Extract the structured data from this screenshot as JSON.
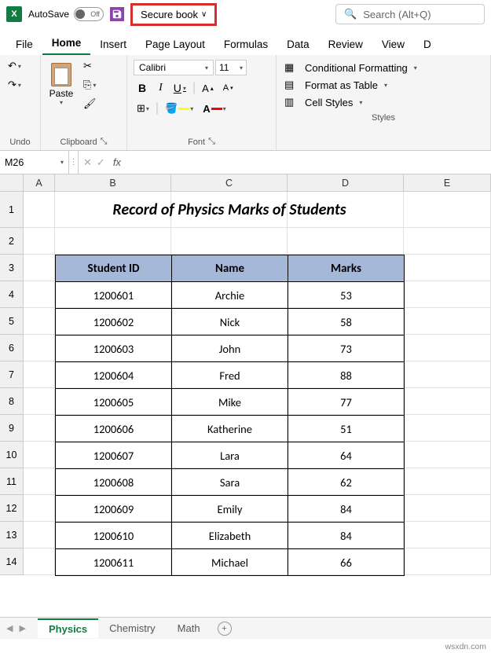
{
  "titleBar": {
    "autoSave": "AutoSave",
    "toggleState": "Off",
    "filename": "Secure book",
    "searchPlaceholder": "Search (Alt+Q)"
  },
  "ribbonTabs": [
    "File",
    "Home",
    "Insert",
    "Page Layout",
    "Formulas",
    "Data",
    "Review",
    "View",
    "D"
  ],
  "activeTab": "Home",
  "ribbon": {
    "undo": {
      "label": "Undo"
    },
    "clipboard": {
      "label": "Clipboard",
      "paste": "Paste"
    },
    "font": {
      "label": "Font",
      "name": "Calibri",
      "size": "11",
      "bold": "B",
      "italic": "I",
      "underline": "U",
      "grow": "A",
      "shrink": "A"
    },
    "styles": {
      "label": "Styles",
      "conditionalFormatting": "Conditional Formatting",
      "formatAsTable": "Format as Table",
      "cellStyles": "Cell Styles"
    }
  },
  "nameBox": "M26",
  "formulaBar": "",
  "columns": [
    "A",
    "B",
    "C",
    "D",
    "E"
  ],
  "rowNumbers": [
    "1",
    "2",
    "3",
    "4",
    "5",
    "6",
    "7",
    "8",
    "9",
    "10",
    "11",
    "12",
    "13",
    "14"
  ],
  "sheetTitle": "Record of Physics Marks of Students",
  "tableHeaders": [
    "Student ID",
    "Name",
    "Marks"
  ],
  "tableData": [
    [
      "1200601",
      "Archie",
      "53"
    ],
    [
      "1200602",
      "Nick",
      "58"
    ],
    [
      "1200603",
      "John",
      "73"
    ],
    [
      "1200604",
      "Fred",
      "88"
    ],
    [
      "1200605",
      "Mike",
      "77"
    ],
    [
      "1200606",
      "Katherine",
      "51"
    ],
    [
      "1200607",
      "Lara",
      "64"
    ],
    [
      "1200608",
      "Sara",
      "62"
    ],
    [
      "1200609",
      "Emily",
      "84"
    ],
    [
      "1200610",
      "Elizabeth",
      "84"
    ],
    [
      "1200611",
      "Michael",
      "66"
    ]
  ],
  "sheetTabs": [
    "Physics",
    "Chemistry",
    "Math"
  ],
  "activeSheetTab": "Physics",
  "watermark": "wsxdn.com"
}
